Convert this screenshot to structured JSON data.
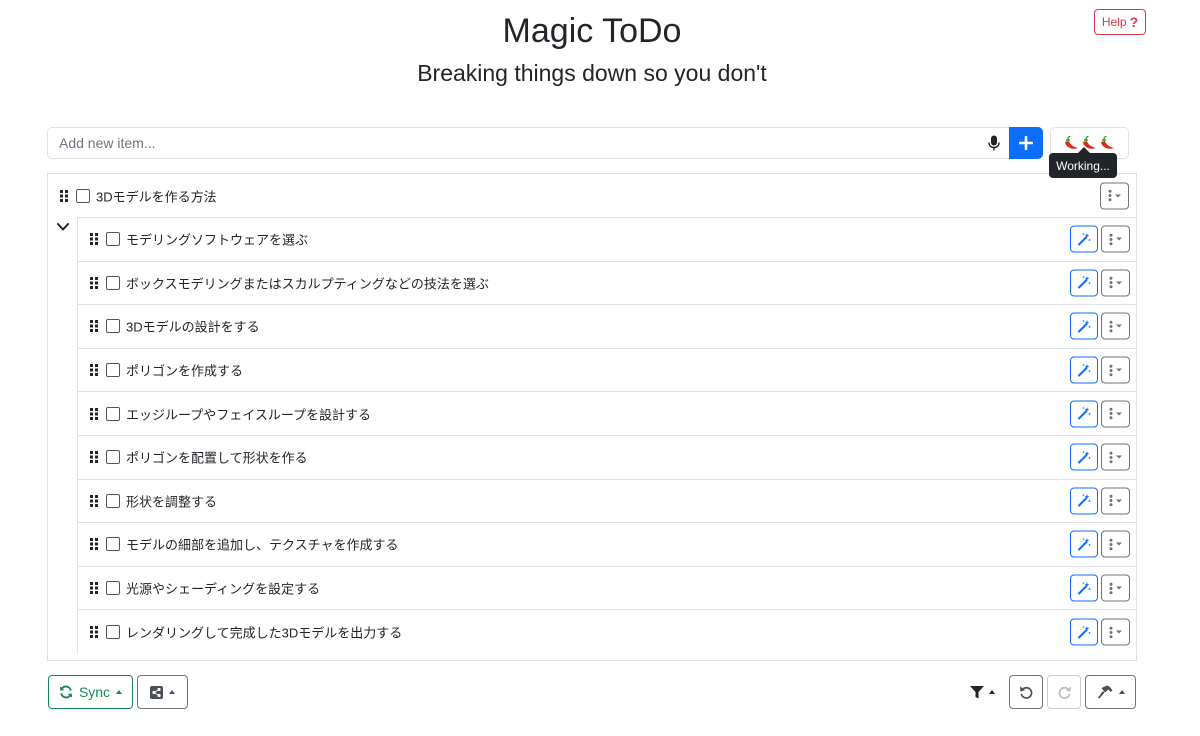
{
  "header": {
    "title": "Magic ToDo",
    "subtitle": "Breaking things down so you don't",
    "help_label": "Help",
    "help_icon_glyph": "?"
  },
  "add_item": {
    "placeholder": "Add new item...",
    "mic_icon": "microphone-icon",
    "add_icon": "plus-icon",
    "spiciness_icon": "chili-pepper-icon",
    "spiciness_level": 3,
    "tooltip": "Working..."
  },
  "root_task": {
    "label": "3Dモデルを作る方法",
    "checked": false,
    "expanded": true
  },
  "subtasks": [
    {
      "label": "モデリングソフトウェアを選ぶ",
      "checked": false
    },
    {
      "label": "ボックスモデリングまたはスカルプティングなどの技法を選ぶ",
      "checked": false
    },
    {
      "label": "3Dモデルの設計をする",
      "checked": false
    },
    {
      "label": "ポリゴンを作成する",
      "checked": false
    },
    {
      "label": "エッジループやフェイスループを設計する",
      "checked": false
    },
    {
      "label": "ポリゴンを配置して形状を作る",
      "checked": false
    },
    {
      "label": "形状を調整する",
      "checked": false
    },
    {
      "label": "モデルの細部を追加し、テクスチャを作成する",
      "checked": false
    },
    {
      "label": "光源やシェーディングを設定する",
      "checked": false
    },
    {
      "label": "レンダリングして完成した3Dモデルを出力する",
      "checked": false
    }
  ],
  "bottom_bar": {
    "sync_label": "Sync"
  },
  "colors": {
    "primary": "#0d6efd",
    "danger": "#dc3545",
    "success": "#198754",
    "secondary": "#6c757d",
    "border": "#dee2e6",
    "tooltip_bg": "#212529"
  }
}
